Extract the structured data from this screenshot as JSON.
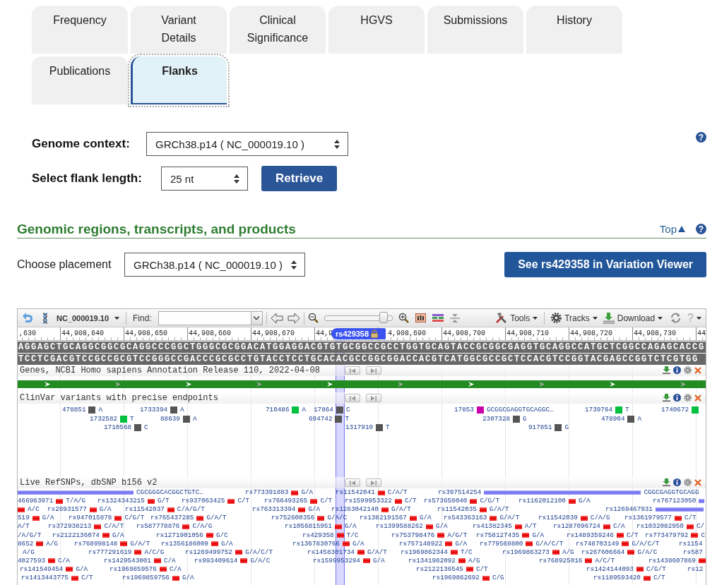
{
  "tabs": [
    {
      "label": "Frequency",
      "selected": false
    },
    {
      "label": "Variant Details",
      "selected": false
    },
    {
      "label": "Clinical Significance",
      "selected": false
    },
    {
      "label": "HGVS",
      "selected": false
    },
    {
      "label": "Submissions",
      "selected": false
    },
    {
      "label": "History",
      "selected": false
    },
    {
      "label": "Publications",
      "selected": false
    },
    {
      "label": "Flanks",
      "selected": true
    }
  ],
  "flank_form": {
    "genome_context_label": "Genome context:",
    "genome_context": "GRCh38.p14 ( NC_000019.10 )",
    "flank_length_label": "Select flank length:",
    "flank_length": "25 nt",
    "retrieve_button": "Retrieve",
    "help": "?"
  },
  "section": {
    "title": "Genomic regions, transcripts, and products",
    "top_link": "Top",
    "help": "?",
    "placement_label": "Choose placement",
    "placement": "GRCh38.p14 ( NC_000019.10 )",
    "viewer_button": "See rs429358 in Variation Viewer"
  },
  "viewer": {
    "toolbar": {
      "sequence": "NC_000019.10",
      "find_label": "Find:",
      "zoom_slider": {
        "level": 0.93
      },
      "tools": "Tools",
      "tracks": "Tracks",
      "download": "Download",
      "help": "?"
    },
    "ruler": [
      ",630",
      "44,908,640",
      "44,908,650",
      "44,908,660",
      "44,908,670",
      "44,9",
      "4,908,690",
      "44,908,700",
      "44,908,710",
      "44,908,720",
      "44,908,730",
      "44"
    ],
    "marker": "rs429358",
    "sequence_forward": "AGGAGCTGCAGGCGGCGCAGGCCCGGCTGGGCGCGGACATGGAGGACGTGTGCGGCCGCCTGGTGCAGTACCGCGGCGAGGTGCAGGCCATGCTCGGCCAGAGCACCG",
    "sequence_reverse": "TCCTCGACGTCCGCCGCGTCCGGGCCGACCCGCGCCTGTACCTCCTGCACACGCCGGCGGACCACGTCATGGCGCCGCTCCACGTCCGGTACGAGCCGGTCTCGTGG",
    "tracks": [
      {
        "kind": "gene",
        "title": "Genes, NCBI Homo sapiens Annotation Release 110, 2022-04-08"
      },
      {
        "kind": "clinvar",
        "title": "ClinVar variants with precise endpoints",
        "variants": [
          {
            "id": "478851",
            "color": "#555555",
            "allele": "A"
          },
          {
            "id": "1733394",
            "color": "#555555",
            "allele": "A"
          },
          {
            "id": "710486",
            "color": "#00c040",
            "allele": "A"
          },
          {
            "id": "17864",
            "color": "#555555",
            "allele": "C"
          },
          {
            "id": "17853",
            "color": "#cc00aa",
            "allele": "GCGGCGAGGTGCAGGC…"
          },
          {
            "id": "1739764",
            "color": "#00c040",
            "allele": "T"
          },
          {
            "id": "1740672",
            "color": "#00c040"
          },
          {
            "id": "1732582",
            "color": "#00c040",
            "allele": "T"
          },
          {
            "id": "88639",
            "color": "#555555",
            "allele": "A"
          },
          {
            "id": "694742",
            "color": "#555555",
            "allele": "T"
          },
          {
            "id": "2307328",
            "color": "#555555",
            "allele": "G"
          },
          {
            "id": "478904",
            "color": "#555555",
            "allele": "A"
          },
          {
            "id": "1710568",
            "color": "#555555",
            "allele": "C"
          },
          {
            "id": "1317910",
            "color": "#555555",
            "allele": "T"
          },
          {
            "id": "917851",
            "color": "#555555",
            "allele": "G"
          }
        ]
      },
      {
        "kind": "snp",
        "title": "Live RefSNPs, dbSNP b156 v2",
        "variants": [
          {
            "kind": "range",
            "label": "CGCGGGCACGGCTGTC…"
          },
          {
            "kind": "snp",
            "id": "rs773391883",
            "alleles": "G/A"
          },
          {
            "kind": "snp",
            "id": "rs11542041",
            "alleles": "C/A/T"
          },
          {
            "kind": "range",
            "id": "rs397514254",
            "label": "CGGCGAGGTGCAGG"
          },
          {
            "kind": "snp",
            "id": "466963971",
            "alleles": "T/A/G"
          },
          {
            "kind": "snp",
            "id": "rs1324343215",
            "alleles": "G/T"
          },
          {
            "kind": "snp",
            "id": "rs937063425",
            "alleles": "C/T"
          },
          {
            "kind": "snp",
            "id": "rs766493265",
            "alleles": "C/T"
          },
          {
            "kind": "snp",
            "id": "rs1599953322",
            "alleles": "C/T"
          },
          {
            "kind": "snp",
            "id": "rs573658040",
            "alleles": "C/G/T"
          },
          {
            "kind": "snp",
            "id": "rs1162012100",
            "alleles": "G/A"
          },
          {
            "kind": "range",
            "id": "rs767123050"
          },
          {
            "kind": "snp",
            "alleles": "A/C"
          },
          {
            "kind": "snp",
            "id": "rs28931577",
            "alleles": "G/A"
          },
          {
            "kind": "snp",
            "id": "rs11542037",
            "alleles": "C/A/G/T"
          },
          {
            "kind": "snp",
            "id": "rs763313394",
            "alleles": "G/A"
          },
          {
            "kind": "snp",
            "id": "rs1263042140",
            "alleles": "G/A/T"
          },
          {
            "kind": "snp",
            "id": "rs11542035",
            "alleles": "G/A/T"
          },
          {
            "kind": "range",
            "id": "rs1269467931"
          },
          {
            "kind": "snp",
            "id": "519",
            "alleles": "G/A"
          },
          {
            "kind": "snp",
            "id": "rs947015878",
            "alleles": "C/G/T"
          },
          {
            "kind": "snp",
            "id": "rs765437285",
            "alleles": "G/A/T"
          },
          {
            "kind": "snp",
            "id": "rs752600356",
            "alleles": "G/A/C"
          },
          {
            "kind": "snp",
            "id": "rs1382191567",
            "alleles": "G/A"
          },
          {
            "kind": "snp",
            "id": "rs543363163",
            "alleles": "G/A/T"
          },
          {
            "kind": "snp",
            "id": "rs11542039",
            "alleles": "C/A/G"
          },
          {
            "kind": "snp",
            "id": "rs1361979577",
            "alleles": "C/T"
          },
          {
            "kind": "tail",
            "alleles": "A/T"
          },
          {
            "kind": "snp",
            "id": "rs372938213",
            "alleles": "C/A/T"
          },
          {
            "kind": "snp",
            "id": "rs587778876",
            "alleles": "C/A/G"
          },
          {
            "kind": "snp",
            "id": "rs1056815951",
            "alleles": "G/A"
          },
          {
            "kind": "snp",
            "id": "rs1399588262",
            "alleles": "G/A"
          },
          {
            "kind": "snp",
            "id": "rs41382345",
            "alleles": "A/T"
          },
          {
            "kind": "snp",
            "id": "rs1287096724",
            "alleles": "C/A"
          },
          {
            "kind": "snp",
            "id": "rs1032082950",
            "alleles": "C/"
          },
          {
            "kind": "tail",
            "alleles": "/A/G/T"
          },
          {
            "kind": "snp",
            "id": "rs2122136074",
            "alleles": "G/A"
          },
          {
            "kind": "snp",
            "id": "rs1271901056",
            "alleles": "G/C"
          },
          {
            "kind": "snp",
            "id": "rs429358",
            "alleles": "T/C"
          },
          {
            "kind": "snp",
            "id": "rs753798476",
            "alleles": "A/G/T"
          },
          {
            "kind": "snp",
            "id": "rs758127435",
            "alleles": "G/A"
          },
          {
            "kind": "snp",
            "id": "rs1489359246",
            "alleles": "C/T"
          },
          {
            "kind": "snp",
            "id": "rs773479792",
            "alleles": "C"
          },
          {
            "kind": "snp",
            "id": "8652",
            "alleles": "A/G"
          },
          {
            "kind": "snp",
            "id": "rs768998148",
            "alleles": "G/A/T"
          },
          {
            "kind": "snp",
            "id": "rs1356186009",
            "alleles": "G/A"
          },
          {
            "kind": "snp",
            "id": "rs1367830766",
            "alleles": "G/A"
          },
          {
            "kind": "snp",
            "id": "rs757148922",
            "alleles": "G/A"
          },
          {
            "kind": "snp",
            "id": "rs779569800",
            "alleles": "G/A/C/T"
          },
          {
            "kind": "snp",
            "id": "rs748703149",
            "alleles": "G/A/C/T"
          },
          {
            "kind": "tail",
            "id": "rs1154"
          },
          {
            "kind": "tail",
            "alleles": "A/G"
          },
          {
            "kind": "snp",
            "id": "rs777291619",
            "alleles": "A/C/G"
          },
          {
            "kind": "snp",
            "id": "rs1269499752",
            "alleles": "G/A/C/T"
          },
          {
            "kind": "snp",
            "id": "rs1458301734",
            "alleles": "G/A/T"
          },
          {
            "kind": "snp",
            "id": "rs1969862344",
            "alleles": "T/C"
          },
          {
            "kind": "snp",
            "id": "rs1969863273",
            "alleles": "A/G"
          },
          {
            "kind": "snp",
            "id": "rs267606664",
            "alleles": "G/A/C"
          },
          {
            "kind": "tail",
            "id": "rs587"
          },
          {
            "kind": "snp",
            "id": "4027593",
            "alleles": "C/A"
          },
          {
            "kind": "snp",
            "id": "rs1429543001",
            "alleles": "C/A"
          },
          {
            "kind": "snp",
            "id": "rs993409614",
            "alleles": "G/A/C"
          },
          {
            "kind": "snp",
            "id": "rs1599953294",
            "alleles": "G/A"
          },
          {
            "kind": "snp",
            "id": "rs1341982092",
            "alleles": "A/G"
          },
          {
            "kind": "snp",
            "id": "rs768925016",
            "alleles": "A/C/T"
          },
          {
            "kind": "snp",
            "id": "rs1438607869"
          },
          {
            "kind": "snp",
            "id": "rs141549454",
            "alleles": "G/A"
          },
          {
            "kind": "snp",
            "id": "rs1969859576",
            "alleles": "C/A"
          },
          {
            "kind": "snp",
            "id": "rs2122136545",
            "alleles": "C/T"
          },
          {
            "kind": "snp",
            "id": "rs1424144093",
            "alleles": "C/G/T"
          },
          {
            "kind": "tail",
            "id": "rs12"
          },
          {
            "kind": "snp",
            "id": "rs1413443775",
            "alleles": "C/T"
          },
          {
            "kind": "snp",
            "id": "rs1969859756",
            "alleles": "G/A"
          },
          {
            "kind": "snp",
            "id": "rs1969862692",
            "alleles": "C/G"
          },
          {
            "kind": "snp",
            "id": "rs1189593420",
            "alleles": "C/T"
          }
        ]
      }
    ]
  }
}
